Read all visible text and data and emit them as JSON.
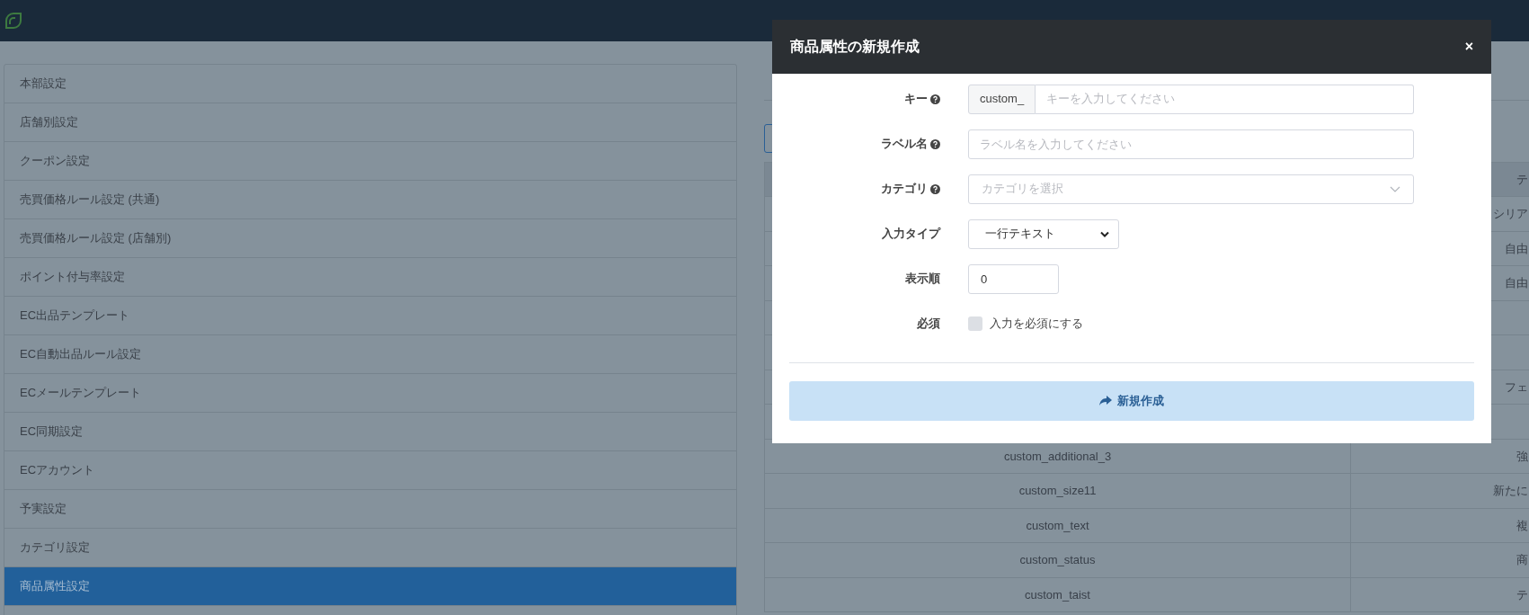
{
  "sidebar": {
    "items": [
      {
        "label": "本部設定",
        "selected": false
      },
      {
        "label": "店舗別設定",
        "selected": false
      },
      {
        "label": "クーポン設定",
        "selected": false
      },
      {
        "label": "売買価格ルール設定 (共通)",
        "selected": false
      },
      {
        "label": "売買価格ルール設定 (店舗別)",
        "selected": false
      },
      {
        "label": "ポイント付与率設定",
        "selected": false
      },
      {
        "label": "EC出品テンプレート",
        "selected": false
      },
      {
        "label": "EC自動出品ルール設定",
        "selected": false
      },
      {
        "label": "ECメールテンプレート",
        "selected": false
      },
      {
        "label": "EC同期設定",
        "selected": false
      },
      {
        "label": "ECアカウント",
        "selected": false
      },
      {
        "label": "予実設定",
        "selected": false
      },
      {
        "label": "カテゴリ設定",
        "selected": false
      },
      {
        "label": "商品属性設定",
        "selected": true
      }
    ]
  },
  "table": {
    "columns": {
      "column_2": "テ"
    },
    "rows": [
      {
        "column_2": "シリア"
      },
      {
        "column_2": "自由"
      },
      {
        "column_2": "自由"
      },
      {},
      {},
      {
        "column_2": "フェ"
      },
      {},
      {
        "column_1": "custom_additional_3",
        "column_2": "強"
      },
      {
        "column_1": "custom_size11",
        "column_2": "新たに"
      },
      {
        "column_1": "custom_text",
        "column_2": "複"
      },
      {
        "column_1": "custom_status",
        "column_2": "商"
      },
      {
        "column_1": "custom_taist",
        "column_2": "テ"
      }
    ]
  },
  "modal": {
    "title": "商品属性の新規作成",
    "close": "×",
    "fields": [
      {
        "kind": "prefixed",
        "label": "キー",
        "help": true,
        "prefix": "custom_",
        "placeholder": "キーを入力してください"
      },
      {
        "kind": "text",
        "label": "ラベル名",
        "help": true,
        "placeholder": "ラベル名を入力してください"
      },
      {
        "kind": "combobox",
        "label": "カテゴリ",
        "help": true,
        "placeholder": "カテゴリを選択"
      },
      {
        "kind": "select",
        "label": "入力タイプ",
        "value": "一行テキスト"
      },
      {
        "kind": "number",
        "label": "表示順",
        "value": "0"
      },
      {
        "kind": "checkbox",
        "label": "必須",
        "text": "入力を必須にする",
        "checked": false
      }
    ],
    "submit": "新規作成"
  }
}
